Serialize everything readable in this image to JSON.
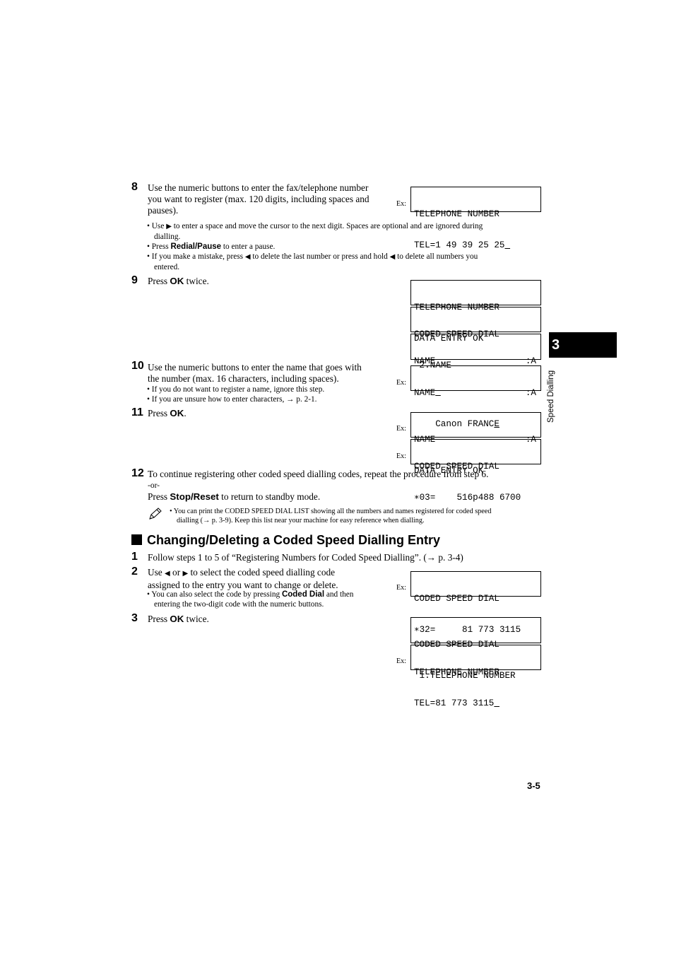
{
  "side_tab": {
    "chapter_number": "3",
    "chapter_label": "Speed Dialling"
  },
  "page_number": "3-5",
  "ex_label": "Ex:",
  "section1": {
    "step8": {
      "num": "8",
      "lines": [
        "Use the numeric buttons to enter the fax/telephone number",
        "you want to register (max. 120 digits, including spaces and",
        "pauses)."
      ],
      "bullets": {
        "b1_pre": "• Use ",
        "b1_icon": "▶",
        "b1_post": " to enter a space and move the cursor to the next digit. Spaces are optional and are ignored during",
        "b1_cont": "dialling.",
        "b2_pre": "• Press ",
        "b2_bold": "Redial/Pause",
        "b2_post": " to enter a pause.",
        "b3_pre": "• If you make a mistake, press ",
        "b3_icon1": "◀",
        "b3_mid": " to delete the last number or press and hold ",
        "b3_icon2": "◀",
        "b3_post": " to delete all numbers you",
        "b3_cont": "entered."
      }
    },
    "step9": {
      "num": "9",
      "pre": "Press ",
      "bold": "OK",
      "post": " twice."
    },
    "step10": {
      "num": "10",
      "lines": [
        "Use the numeric buttons to enter the name that goes with",
        "the number (max. 16 characters, including spaces)."
      ],
      "bullet1": "• If you do not want to register a name, ignore this step.",
      "bullet2": "• If you are unsure how to enter characters, → p. 2-1."
    },
    "step11": {
      "num": "11",
      "pre": "Press ",
      "bold": "OK",
      "post": "."
    },
    "step12": {
      "num": "12",
      "line1": "To continue registering other coded speed dialling codes, repeat the procedure from step 6.",
      "or": "-or-",
      "pre": "Press ",
      "bold": "Stop/Reset",
      "post": " to return to standby mode."
    },
    "note": {
      "icon": "pencil-icon",
      "line1": "•  You can print the CODED SPEED DIAL LIST showing all the numbers and names registered for coded speed",
      "line2": "dialling (→ p. 3-9). Keep this list near your machine for easy reference when dialling."
    }
  },
  "displays": {
    "d1": {
      "l1": "TELEPHONE NUMBER",
      "l2": "TEL=1 49 39 25 25",
      "cursor": " "
    },
    "d2": {
      "l1": "TELEPHONE NUMBER",
      "l2": "DATA ENTRY OK"
    },
    "d3": {
      "l1": "CODED SPEED DIAL",
      "l2": " 2.NAME"
    },
    "d4": {
      "l1": "NAME",
      "mode": ":A",
      "l2": "    ",
      "cursor": " "
    },
    "d5": {
      "l1": "NAME",
      "mode": ":A",
      "l2": "    Canon FRANC",
      "cursor": "E"
    },
    "d6": {
      "l1": "NAME",
      "mode": ":A",
      "l2": "DATA ENTRY OK"
    },
    "d7": {
      "l1": "CODED SPEED DIAL",
      "l2": "∗03=    516p488 6700"
    },
    "d8": {
      "l1": "CODED SPEED DIAL",
      "l2": "∗32=     81 773 3115"
    },
    "d9": {
      "l1": "CODED SPEED DIAL",
      "l2": " 1.TELEPHONE NUMBER"
    },
    "d10": {
      "l1": "TELEPHONE NUMBER",
      "l2": "TEL=81 773 3115",
      "cursor": " "
    }
  },
  "section2": {
    "heading": "Changing/Deleting a Coded Speed Dialling Entry",
    "step1": {
      "num": "1",
      "text": "Follow steps 1 to 5 of “Registering Numbers for Coded Speed Dialling”. (→ p. 3-4)"
    },
    "step2": {
      "num": "2",
      "l1_pre": "Use ",
      "l1_icon1": "◀",
      "l1_mid": " or ",
      "l1_icon2": "▶",
      "l1_post": " to select the coded speed dialling code",
      "l2": "assigned to the entry you want to change or delete.",
      "b_pre": "• You can also select the code by pressing ",
      "b_bold": "Coded Dial",
      "b_post": " and then",
      "b_cont": "entering the two-digit code with the numeric buttons."
    },
    "step3": {
      "num": "3",
      "pre": "Press ",
      "bold": "OK",
      "post": " twice."
    }
  }
}
